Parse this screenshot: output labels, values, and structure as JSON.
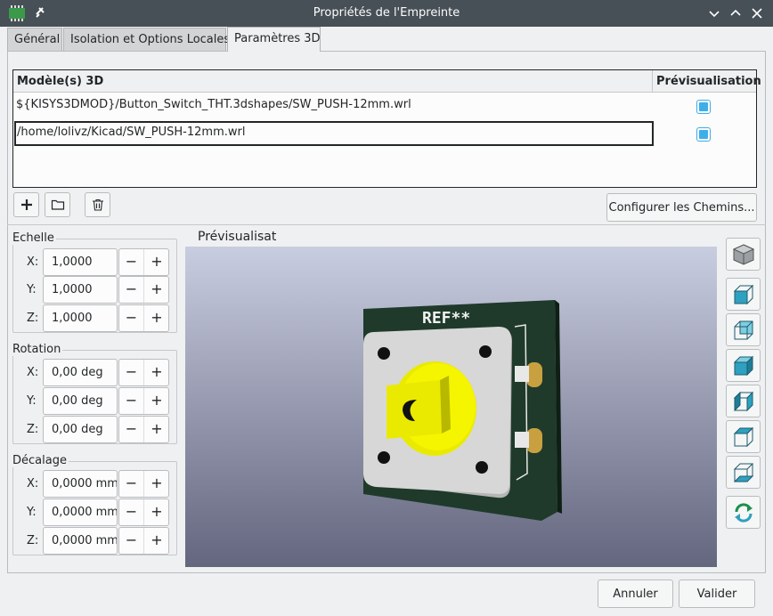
{
  "window": {
    "title": "Propriétés de l'Empreinte"
  },
  "tabs": [
    {
      "label": "Général"
    },
    {
      "label": "Isolation et Options Locales"
    },
    {
      "label": "Paramètres 3D"
    }
  ],
  "models": {
    "col_model": "Modèle(s) 3D",
    "col_preview": "Prévisualisation",
    "rows": [
      {
        "path": "${KISYS3DMOD}/Button_Switch_THT.3dshapes/SW_PUSH-12mm.wrl",
        "preview": true
      },
      {
        "path": "/home/lolivz/Kicad/SW_PUSH-12mm.wrl",
        "preview": true
      }
    ]
  },
  "toolbar": {
    "add_icon": "plus-icon",
    "browse_icon": "folder-icon",
    "delete_icon": "trash-icon",
    "configure_label": "Configurer les Chemins..."
  },
  "scale": {
    "title": "Echelle",
    "x_label": "X:",
    "x": "1,0000",
    "y_label": "Y:",
    "y": "1,0000",
    "z_label": "Z:",
    "z": "1,0000"
  },
  "rotation": {
    "title": "Rotation",
    "x_label": "X:",
    "x": "0,00 deg",
    "y_label": "Y:",
    "y": "0,00 deg",
    "z_label": "Z:",
    "z": "0,00 deg"
  },
  "offset": {
    "title": "Décalage",
    "x_label": "X:",
    "x": "0,0000 mm",
    "y_label": "Y:",
    "y": "0,0000 mm",
    "z_label": "Z:",
    "z": "0,0000 mm"
  },
  "spin": {
    "minus": "−",
    "plus": "+"
  },
  "preview": {
    "label": "Prévisualisat",
    "ref_text": "REF**"
  },
  "view_buttons": [
    "view-3d-icon",
    "view-front-icon",
    "view-back-icon",
    "view-left-icon",
    "view-right-icon",
    "view-top-icon",
    "view-bottom-icon",
    "reload-icon"
  ],
  "footer": {
    "cancel_label": "Annuler",
    "ok_label": "Valider"
  },
  "colors": {
    "accent": "#3daee9",
    "titlebar": "#475057",
    "pcb": "#1f3a2a",
    "body": "#f5f500"
  }
}
